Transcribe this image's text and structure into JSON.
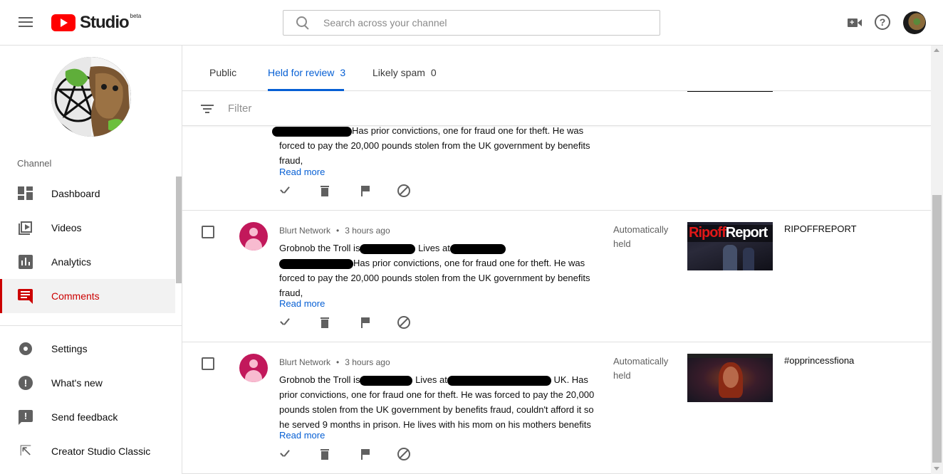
{
  "header": {
    "logo_text": "Studio",
    "logo_badge": "beta",
    "search_placeholder": "Search across your channel"
  },
  "sidebar": {
    "section_label": "Channel",
    "items": [
      {
        "label": "Dashboard",
        "icon": "dashboard-icon"
      },
      {
        "label": "Videos",
        "icon": "videos-icon"
      },
      {
        "label": "Analytics",
        "icon": "analytics-icon"
      },
      {
        "label": "Comments",
        "icon": "comments-icon",
        "active": true
      }
    ],
    "bottom_items": [
      {
        "label": "Settings",
        "icon": "gear-icon"
      },
      {
        "label": "What's new",
        "icon": "whats-new-icon"
      },
      {
        "label": "Send feedback",
        "icon": "feedback-icon"
      },
      {
        "label": "Creator Studio Classic",
        "icon": "exit-icon"
      }
    ]
  },
  "tabs": [
    {
      "label": "Public",
      "count": ""
    },
    {
      "label": "Held for review",
      "count": "3",
      "active": true
    },
    {
      "label": "Likely spam",
      "count": "0"
    }
  ],
  "filter": {
    "placeholder": "Filter"
  },
  "comments": [
    {
      "author": "",
      "time": "",
      "text_line1_after_redaction": "Has prior convictions, one for fraud one for theft. He was",
      "text_line2": "forced to pay the 20,000 pounds stolen from the UK government by benefits",
      "text_line3": "fraud,",
      "read_more": "Read more",
      "status": "",
      "video_title": ""
    },
    {
      "author": "Blurt Network",
      "time": "3 hours ago",
      "text_prefix": "Grobnob the Troll is",
      "text_mid": "Lives at",
      "text_line2_after_redaction": "Has prior convictions, one for fraud one for theft. He was",
      "text_line3": "forced to pay the 20,000 pounds stolen from the UK government by benefits",
      "text_line4": "fraud,",
      "read_more": "Read more",
      "status": "Automatically held",
      "thumbnail_text_1": "Ripoff",
      "thumbnail_text_2": "Report",
      "video_title": "RIPOFFREPORT"
    },
    {
      "author": "Blurt Network",
      "time": "3 hours ago",
      "text_prefix": "Grobnob the Troll is",
      "text_mid": "Lives at",
      "text_after": "UK. Has",
      "text_line2": "prior convictions, one for fraud one for theft. He was forced to pay the 20,000",
      "text_line3": "pounds stolen from the UK government by benefits fraud, couldn't afford it so",
      "text_line4": "he served 9 months in prison. He lives with his mom on his mothers benefits",
      "read_more": "Read more",
      "status": "Automatically held",
      "video_title": "#opprincessfiona"
    }
  ],
  "colors": {
    "accent": "#065fd4",
    "active_nav": "#cc0000",
    "brand_red": "#ff0000"
  }
}
